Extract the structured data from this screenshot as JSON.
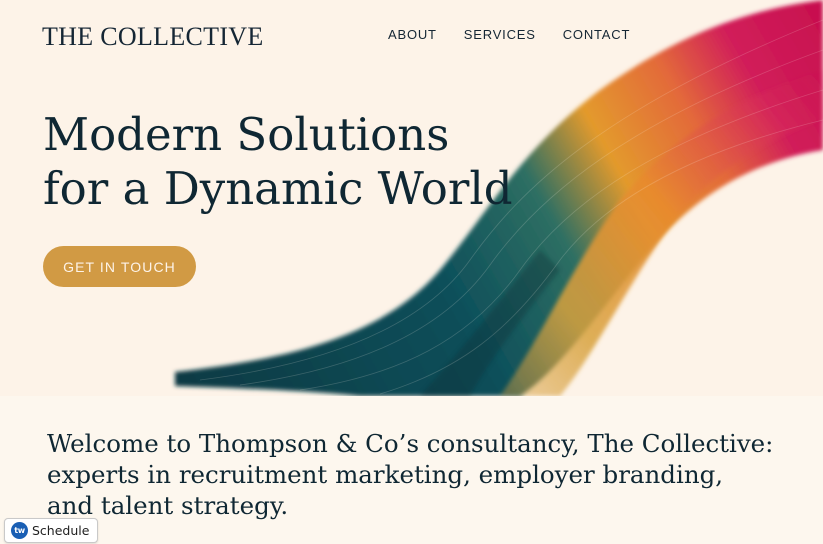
{
  "header": {
    "logo": "THE COLLECTIVE",
    "nav": [
      {
        "label": "ABOUT"
      },
      {
        "label": "SERVICES"
      },
      {
        "label": "CONTACT"
      }
    ]
  },
  "hero": {
    "headline_line1": "Modern Solutions",
    "headline_line2": "for a Dynamic World",
    "cta_label": "GET IN TOUCH",
    "image": "abstract-brush-stroke"
  },
  "intro": {
    "line1": "Welcome to Thompson & Co’s consultancy, The Collective:",
    "line2": "experts in recruitment marketing, employer branding,",
    "line3": "and talent strategy."
  },
  "widget": {
    "icon": "tw-logo-icon",
    "icon_text": "tw",
    "label": "Schedule"
  },
  "colors": {
    "background": "#fdf3e8",
    "text": "#0f2733",
    "cta": "#d19a44",
    "brush_magenta": "#d11e5a",
    "brush_orange": "#e69a2a",
    "brush_teal": "#0d4f5a"
  }
}
